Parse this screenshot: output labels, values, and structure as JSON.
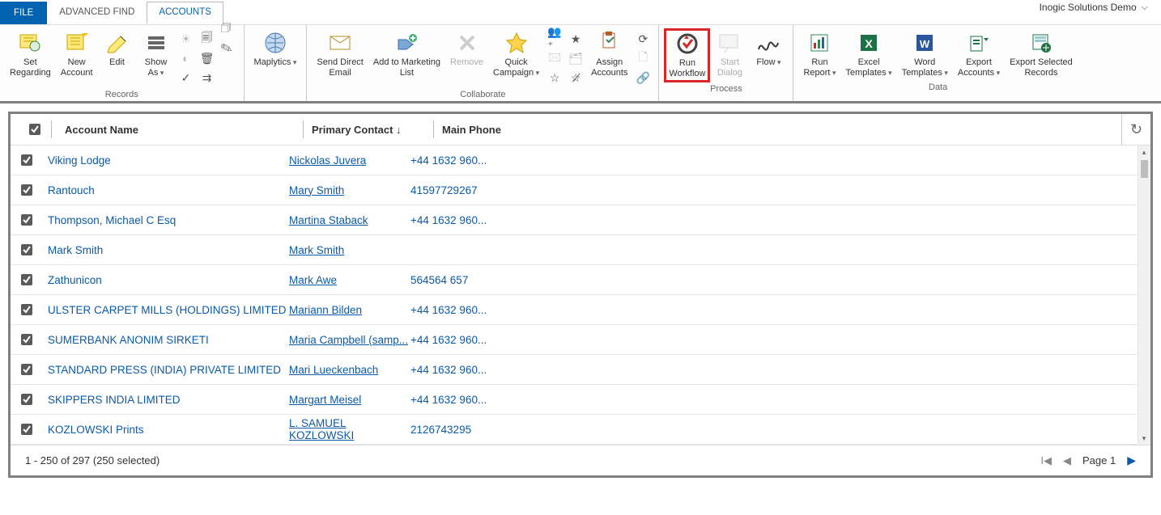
{
  "header": {
    "tabs": {
      "file": "FILE",
      "adv": "ADVANCED FIND",
      "accounts": "ACCOUNTS"
    },
    "org": "Inogic Solutions Demo"
  },
  "ribbon": {
    "records": {
      "label": "Records",
      "set_regarding": "Set\nRegarding",
      "new_account": "New\nAccount",
      "edit": "Edit",
      "show_as": "Show\nAs"
    },
    "maplytics": {
      "label": "Maplytics"
    },
    "collaborate": {
      "label": "Collaborate",
      "send_email": "Send Direct\nEmail",
      "add_marketing": "Add to Marketing\nList",
      "remove": "Remove",
      "quick_campaign": "Quick\nCampaign",
      "assign": "Assign\nAccounts"
    },
    "process": {
      "label": "Process",
      "run_workflow": "Run\nWorkflow",
      "start_dialog": "Start\nDialog",
      "flow": "Flow"
    },
    "data": {
      "label": "Data",
      "run_report": "Run\nReport",
      "excel": "Excel\nTemplates",
      "word": "Word\nTemplates",
      "export_acc": "Export\nAccounts",
      "export_sel": "Export Selected\nRecords"
    }
  },
  "grid": {
    "headers": {
      "account": "Account Name",
      "contact": "Primary Contact",
      "phone": "Main Phone"
    },
    "rows": [
      {
        "account": "Viking Lodge",
        "contact": "Nickolas Juvera",
        "phone": "+44 1632 960..."
      },
      {
        "account": "Rantouch",
        "contact": "Mary Smith",
        "phone": "41597729267"
      },
      {
        "account": "Thompson, Michael C Esq",
        "contact": "Martina Staback",
        "phone": "+44 1632 960..."
      },
      {
        "account": "Mark Smith",
        "contact": "Mark Smith",
        "phone": ""
      },
      {
        "account": "Zathunicon",
        "contact": "Mark Awe",
        "phone": "564564 657"
      },
      {
        "account": "ULSTER CARPET MILLS (HOLDINGS) LIMITED",
        "contact": "Mariann Bilden",
        "phone": "+44 1632 960..."
      },
      {
        "account": "SUMERBANK ANONIM SIRKETI",
        "contact": "Maria Campbell (samp...",
        "phone": "+44 1632 960..."
      },
      {
        "account": "STANDARD PRESS (INDIA) PRIVATE LIMITED",
        "contact": "Mari Lueckenbach",
        "phone": "+44 1632 960..."
      },
      {
        "account": "SKIPPERS INDIA LIMITED",
        "contact": "Margart Meisel",
        "phone": "+44 1632 960..."
      },
      {
        "account": "KOZLOWSKI Prints",
        "contact": "L. SAMUEL KOZLOWSKI",
        "phone": "2126743295"
      }
    ],
    "footer": {
      "status": "1 - 250 of 297 (250 selected)",
      "page": "Page 1"
    }
  }
}
